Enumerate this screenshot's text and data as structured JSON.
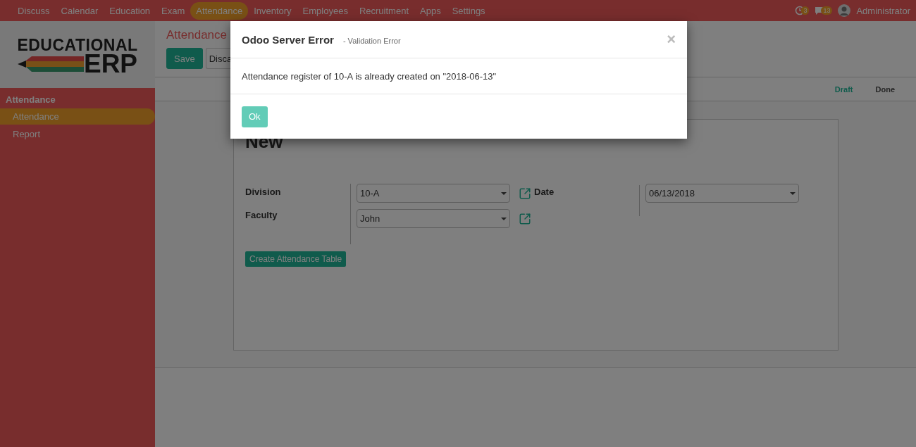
{
  "navbar": {
    "menu": [
      {
        "label": "Discuss",
        "selected": false
      },
      {
        "label": "Calendar",
        "selected": false
      },
      {
        "label": "Education",
        "selected": false
      },
      {
        "label": "Exam",
        "selected": false
      },
      {
        "label": "Attendance",
        "selected": true
      },
      {
        "label": "Inventory",
        "selected": false
      },
      {
        "label": "Employees",
        "selected": false
      },
      {
        "label": "Recruitment",
        "selected": false
      },
      {
        "label": "Apps",
        "selected": false
      },
      {
        "label": "Settings",
        "selected": false
      }
    ],
    "activity_count": "3",
    "message_count": "13",
    "user": "Administrator"
  },
  "sidebar": {
    "logo": {
      "line1": "EDUCATIONAL",
      "line2": "ERP"
    },
    "section": "Attendance",
    "items": [
      {
        "label": "Attendance",
        "selected": true
      },
      {
        "label": "Report",
        "selected": false
      }
    ]
  },
  "control_panel": {
    "breadcrumb": "Attendance",
    "buttons": [
      {
        "label": "Save",
        "kind": "primary"
      },
      {
        "label": "Disca",
        "kind": "secondary"
      }
    ]
  },
  "statusbar": [
    {
      "label": "Draft",
      "selected": true
    },
    {
      "label": "Done",
      "selected": false
    }
  ],
  "form": {
    "title": "New",
    "fields": [
      {
        "label": "Division",
        "value": "10-A"
      },
      {
        "label": "Faculty",
        "value": "John"
      }
    ],
    "date": {
      "label": "Date",
      "value": "06/13/2018"
    },
    "action": "Create Attendance Table"
  },
  "dialog": {
    "title": "Odoo Server Error",
    "subtitle": "- Validation Error",
    "close": "×",
    "message": "Attendance register of 10-A is already created on \"2018-06-13\"",
    "button": "Ok"
  }
}
